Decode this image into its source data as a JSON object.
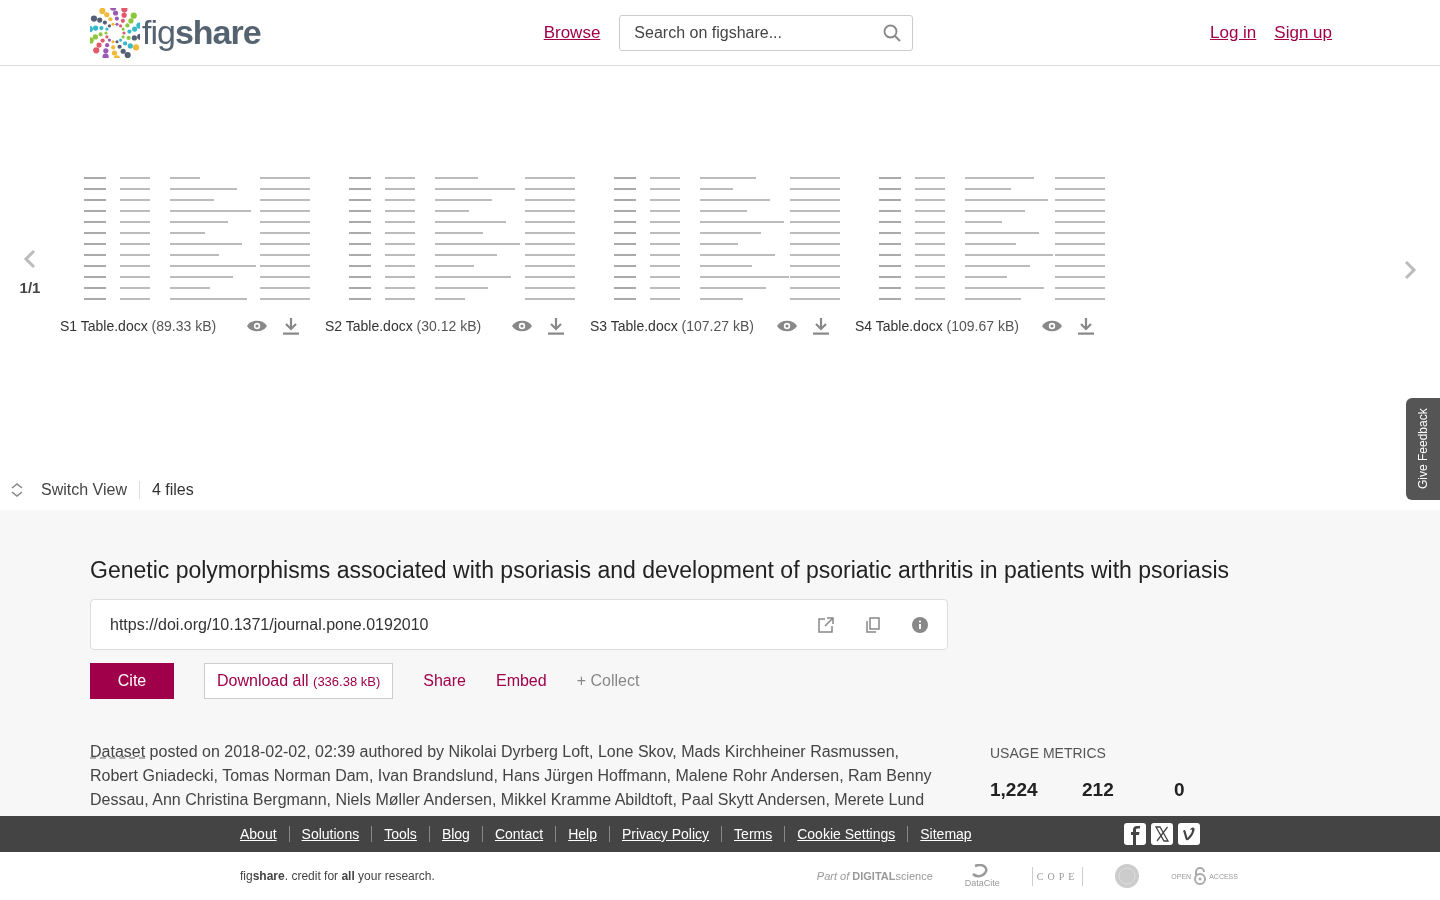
{
  "header": {
    "logo": "fig**share**",
    "nav_link": "Browse",
    "search": {
      "placeholder": "Search on figshare..."
    },
    "auth_links": [
      "Log in",
      "Sign up"
    ]
  },
  "carousel": {
    "page": "1/1",
    "files": [
      {
        "name": "S1 Table.docx",
        "size": "(89.33 kB)"
      },
      {
        "name": "S2 Table.docx",
        "size": "(30.12 kB)"
      },
      {
        "name": "S3 Table.docx",
        "size": "(107.27 kB)"
      },
      {
        "name": "S4 Table.docx",
        "size": "(109.67 kB)"
      }
    ]
  },
  "feedback_tab": "Give Feedback",
  "view_bar": {
    "switch_label": "Switch View",
    "file_count": "4 files"
  },
  "item": {
    "title": "Genetic polymorphisms associated with psoriasis and development of psoriatic arthritis in patients with psoriasis",
    "doi": "https://doi.org/10.1371/journal.pone.0192010",
    "actions": {
      "cite": "Cite",
      "download": "Download all",
      "download_size": "(336.38 kB)",
      "share": "Share",
      "embed": "Embed",
      "collect": "+ Collect"
    },
    "type_link": "Dataset",
    "byline": "posted on 2018-02-02, 02:39 authored by Nikolai Dyrberg Loft, Lone Skov, Mads Kirchheiner Rasmussen, Robert Gniadecki, Tomas Norman Dam, Ivan Brandslund, Hans Jürgen Hoffmann, Malene Rohr Andersen, Ram Benny Dessau, Ann Christina Bergmann, Niels Møller Andersen, Mikkel Kramme Abildtoft, Paal Skytt Andersen, Merete Lund"
  },
  "usage_metrics": {
    "heading": "USAGE METRICS",
    "values": [
      "1,224",
      "212",
      "0"
    ]
  },
  "footer": {
    "links": [
      "About",
      "Solutions",
      "Tools",
      "Blog",
      "Contact",
      "Help",
      "Privacy Policy",
      "Terms",
      "Cookie Settings",
      "Sitemap"
    ],
    "tagline": "fig**share**. credit for **all** your research.",
    "partners": [
      {
        "kind": "digital-science",
        "text": "*Part of* **DIGITAL**science"
      },
      {
        "kind": "datacite",
        "text": "DataCite"
      },
      {
        "kind": "cope",
        "text": "COPE"
      },
      {
        "kind": "seal"
      },
      {
        "kind": "open-access",
        "text": "OPEN",
        "text2": "ACCESS"
      }
    ]
  }
}
